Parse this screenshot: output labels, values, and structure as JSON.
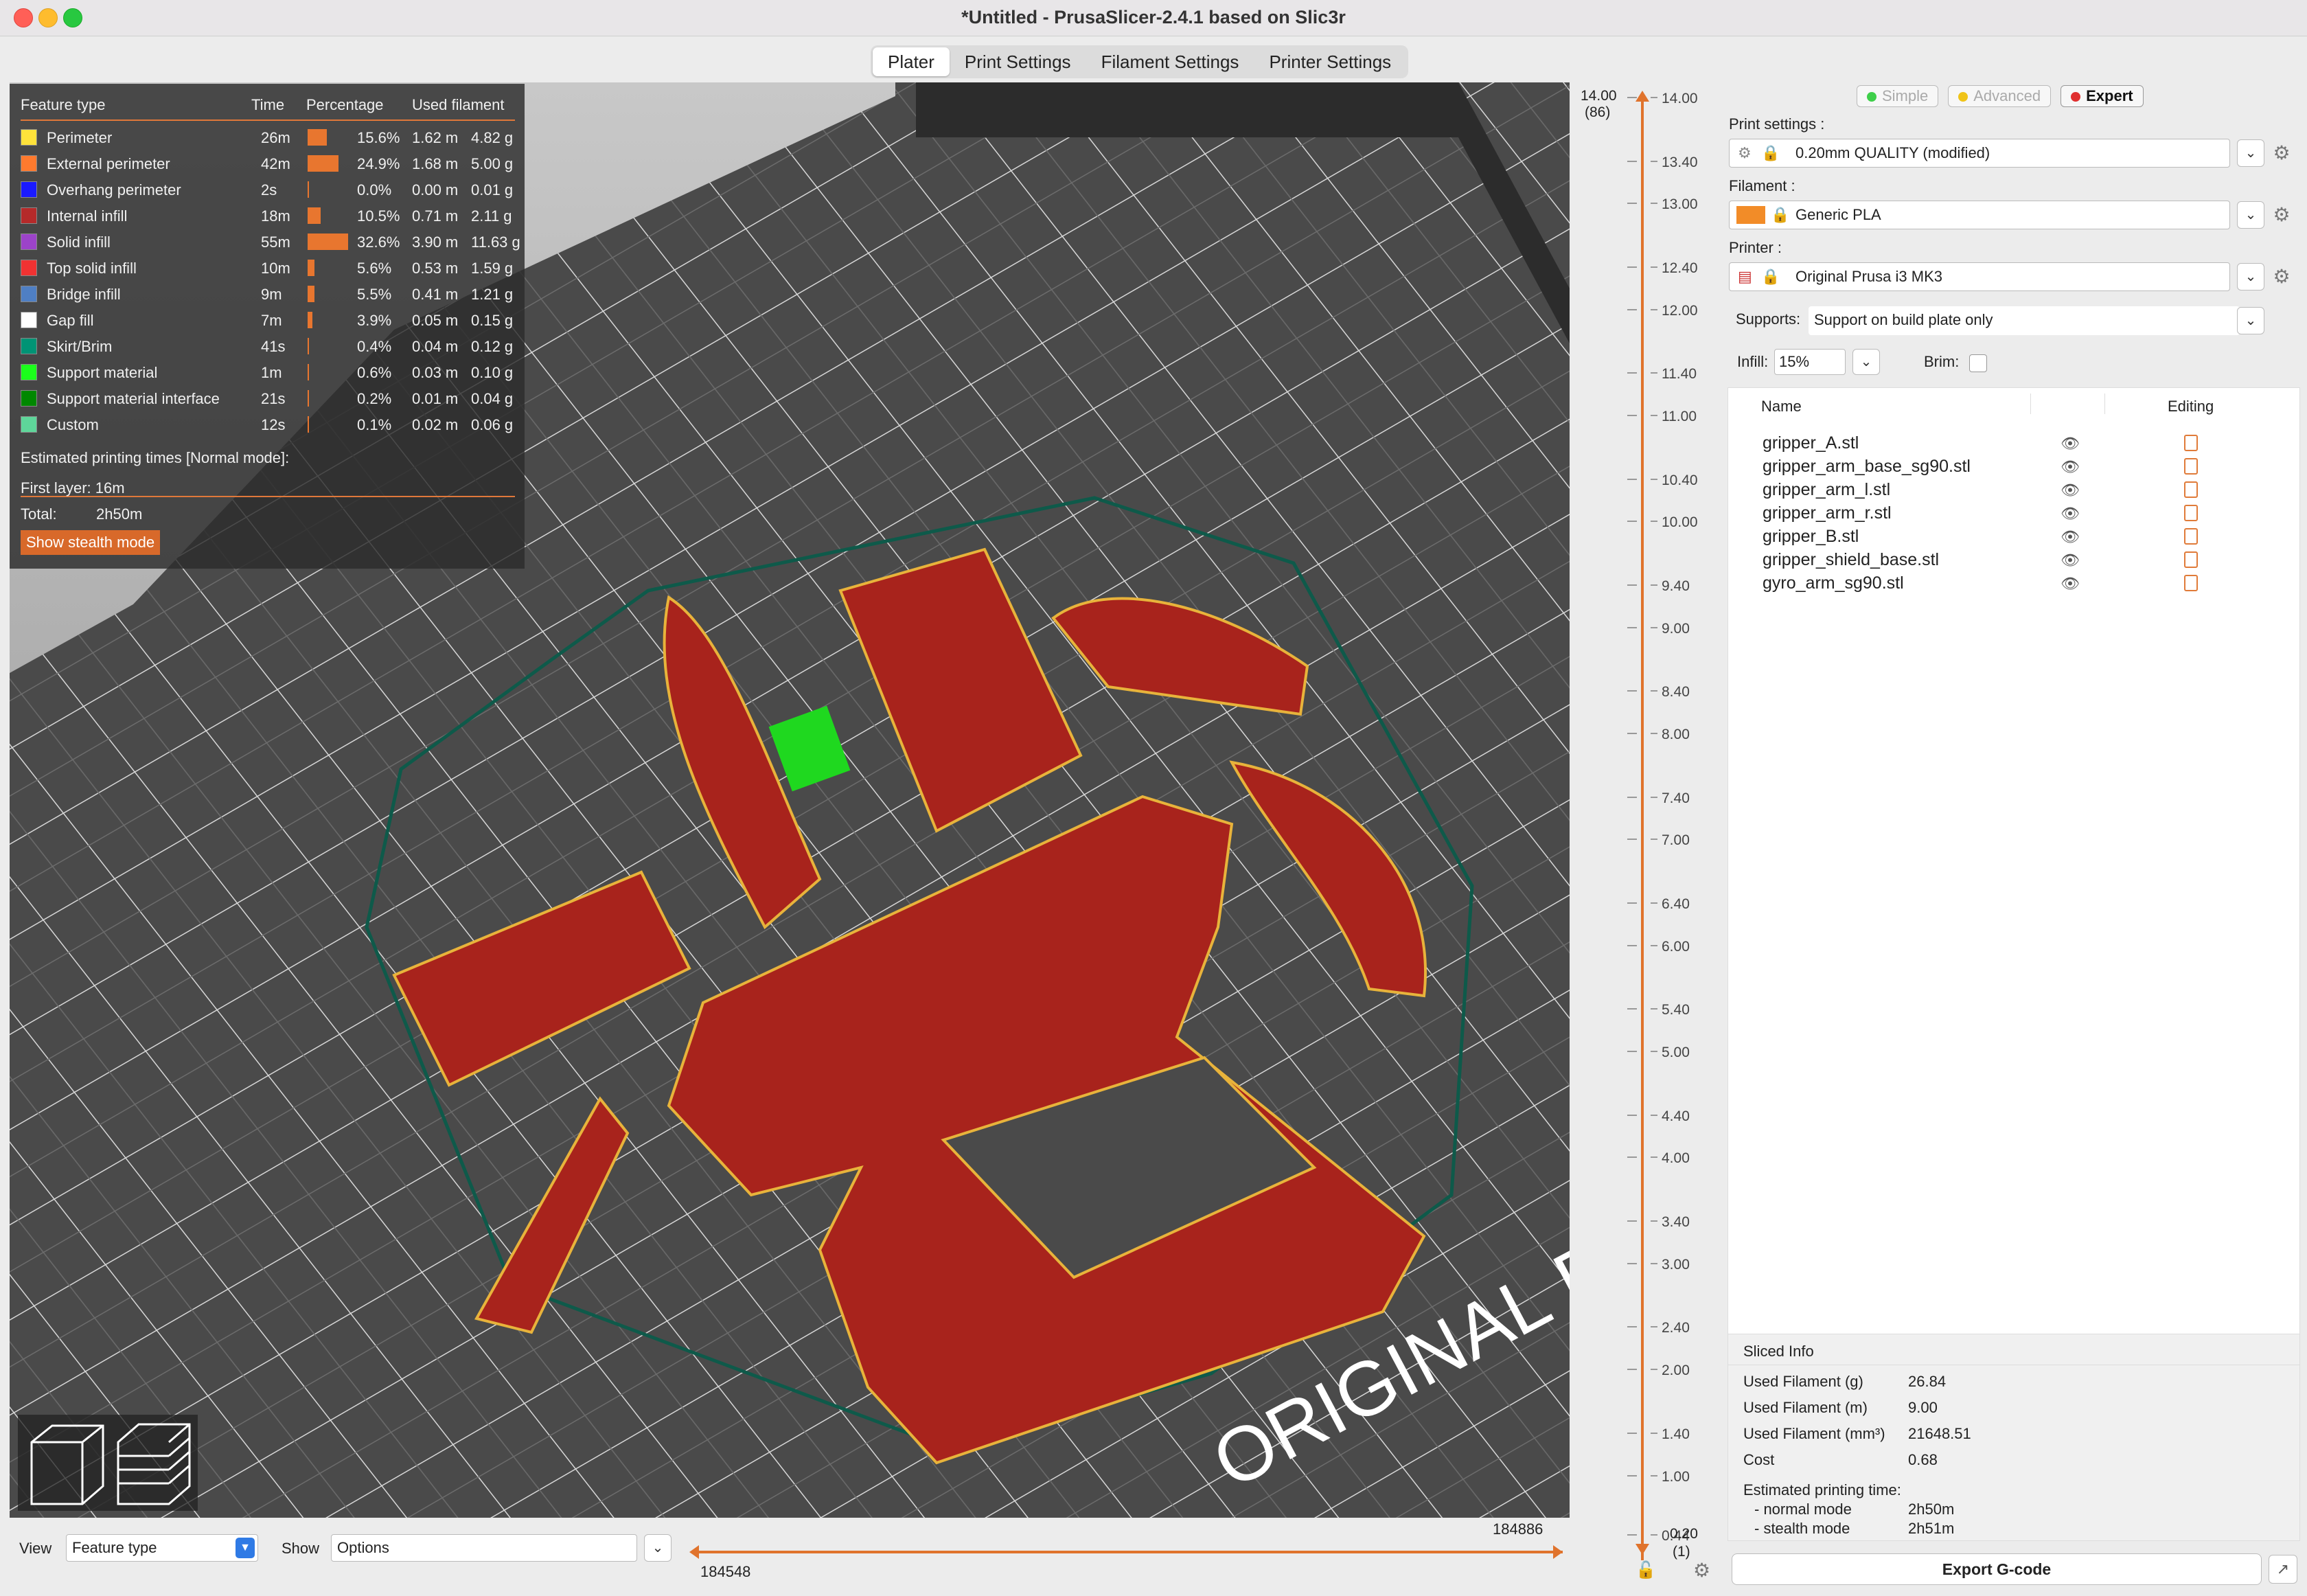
{
  "window": {
    "title": "*Untitled - PrusaSlicer-2.4.1 based on Slic3r"
  },
  "tabs": [
    "Plater",
    "Print Settings",
    "Filament Settings",
    "Printer Settings"
  ],
  "legend": {
    "headers": [
      "Feature type",
      "Time",
      "Percentage",
      "Used filament"
    ],
    "rows": [
      {
        "name": "Perimeter",
        "color": "#ffe23a",
        "time": "26m",
        "pct": "15.6%",
        "len": "1.62 m",
        "weight": "4.82 g",
        "frac": 0.156
      },
      {
        "name": "External perimeter",
        "color": "#ff7a2e",
        "time": "42m",
        "pct": "24.9%",
        "len": "1.68 m",
        "weight": "5.00 g",
        "frac": 0.249
      },
      {
        "name": "Overhang perimeter",
        "color": "#1a1aff",
        "time": "2s",
        "pct": "0.0%",
        "len": "0.00 m",
        "weight": "0.01 g",
        "frac": 0.0
      },
      {
        "name": "Internal infill",
        "color": "#b52a2a",
        "time": "18m",
        "pct": "10.5%",
        "len": "0.71 m",
        "weight": "2.11 g",
        "frac": 0.105
      },
      {
        "name": "Solid infill",
        "color": "#9c43c9",
        "time": "55m",
        "pct": "32.6%",
        "len": "3.90 m",
        "weight": "11.63 g",
        "frac": 0.326
      },
      {
        "name": "Top solid infill",
        "color": "#f03232",
        "time": "10m",
        "pct": "5.6%",
        "len": "0.53 m",
        "weight": "1.59 g",
        "frac": 0.056
      },
      {
        "name": "Bridge infill",
        "color": "#4f7fc4",
        "time": "9m",
        "pct": "5.5%",
        "len": "0.41 m",
        "weight": "1.21 g",
        "frac": 0.055
      },
      {
        "name": "Gap fill",
        "color": "#ffffff",
        "time": "7m",
        "pct": "3.9%",
        "len": "0.05 m",
        "weight": "0.15 g",
        "frac": 0.039
      },
      {
        "name": "Skirt/Brim",
        "color": "#009475",
        "time": "41s",
        "pct": "0.4%",
        "len": "0.04 m",
        "weight": "0.12 g",
        "frac": 0.004
      },
      {
        "name": "Support material",
        "color": "#1bff1b",
        "time": "1m",
        "pct": "0.6%",
        "len": "0.03 m",
        "weight": "0.10 g",
        "frac": 0.006
      },
      {
        "name": "Support material interface",
        "color": "#008800",
        "time": "21s",
        "pct": "0.2%",
        "len": "0.01 m",
        "weight": "0.04 g",
        "frac": 0.002
      },
      {
        "name": "Custom",
        "color": "#5ed69a",
        "time": "12s",
        "pct": "0.1%",
        "len": "0.02 m",
        "weight": "0.06 g",
        "frac": 0.001
      }
    ],
    "est_label": "Estimated printing times [Normal mode]:",
    "first_layer": "First layer: 16m",
    "total_label": "Total:",
    "total_value": "2h50m",
    "stealth_button": "Show stealth mode"
  },
  "bed_text": "ORIGINAL PR",
  "ruler": {
    "top_value": "14.00",
    "top_layer": "(86)",
    "ticks": [
      "14.00",
      "13.40",
      "13.00",
      "12.40",
      "12.00",
      "11.40",
      "11.00",
      "10.40",
      "10.00",
      "9.40",
      "9.00",
      "8.40",
      "8.00",
      "7.40",
      "7.00",
      "6.40",
      "6.00",
      "5.40",
      "5.00",
      "4.40",
      "4.00",
      "3.40",
      "3.00",
      "2.40",
      "2.00",
      "1.40",
      "1.00",
      "0.44"
    ],
    "bottom_value": "0.20",
    "bottom_layer": "(1)"
  },
  "bottom": {
    "view_label": "View",
    "view_value": "Feature type",
    "show_label": "Show",
    "show_value": "Options",
    "slider_min": "184548",
    "slider_max": "184886"
  },
  "sidebar": {
    "modes": [
      {
        "label": "Simple",
        "color": "#3ecf4a"
      },
      {
        "label": "Advanced",
        "color": "#f0c419"
      },
      {
        "label": "Expert",
        "color": "#e03030"
      }
    ],
    "print_label": "Print settings :",
    "print_value": "0.20mm QUALITY (modified)",
    "filament_label": "Filament :",
    "filament_value": "Generic PLA",
    "filament_color": "#f28c28",
    "printer_label": "Printer :",
    "printer_value": "Original Prusa i3 MK3",
    "supports_label": "Supports:",
    "supports_value": "Support on build plate only",
    "infill_label": "Infill:",
    "infill_value": "15%",
    "brim_label": "Brim:",
    "col_name": "Name",
    "col_editing": "Editing",
    "objects": [
      "gripper_A.stl",
      "gripper_arm_base_sg90.stl",
      "gripper_arm_l.stl",
      "gripper_arm_r.stl",
      "gripper_B.stl",
      "gripper_shield_base.stl",
      "gyro_arm_sg90.stl"
    ],
    "sliced": {
      "title": "Sliced Info",
      "rows": [
        [
          "Used Filament (g)",
          "26.84"
        ],
        [
          "Used Filament (m)",
          "9.00"
        ],
        [
          "Used Filament (mm³)",
          "21648.51"
        ],
        [
          "Cost",
          "0.68"
        ]
      ],
      "est_label": "Estimated printing time:",
      "normal_label": "- normal mode",
      "normal_value": "2h50m",
      "stealth_label": "- stealth mode",
      "stealth_value": "2h51m"
    },
    "export_button": "Export G-code"
  }
}
